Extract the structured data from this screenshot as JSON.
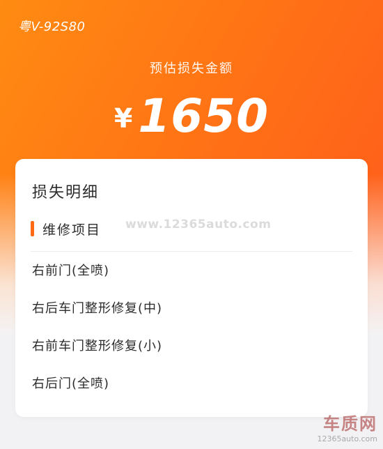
{
  "header": {
    "plate": "粤V-92S80",
    "estimate_label": "预估损失金额",
    "currency_symbol": "¥",
    "amount": "1650"
  },
  "card": {
    "title": "损失明细",
    "section_label": "维修项目",
    "accent_color": "#ff6a13",
    "items": [
      {
        "label": "右前门(全喷)"
      },
      {
        "label": "右后车门整形修复(中)"
      },
      {
        "label": "右前车门整形修复(小)"
      },
      {
        "label": "右后门(全喷)"
      }
    ]
  },
  "overlay": {
    "watermark": "www.12365auto.com",
    "logo_name": "车质网",
    "logo_url": "12365auto.com"
  },
  "colors": {
    "gradient_start": "#ff8b12",
    "gradient_end": "#ff5a1c",
    "background": "#f2f2f4"
  }
}
